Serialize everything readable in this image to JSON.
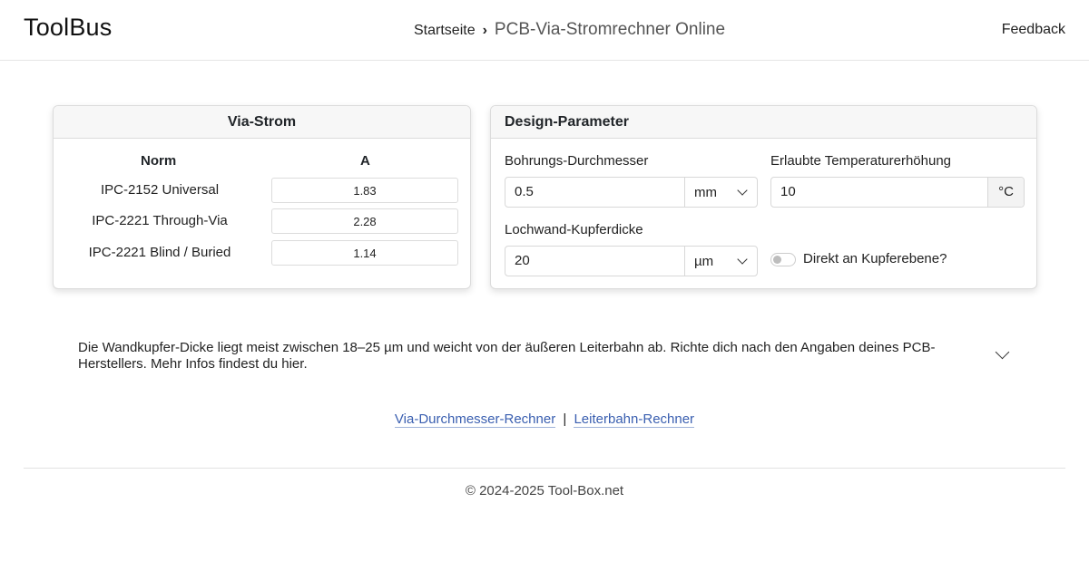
{
  "header": {
    "brand": "ToolBus",
    "breadcrumb_home": "Startseite",
    "breadcrumb_separator": "›",
    "breadcrumb_current": "PCB-Via-Stromrechner Online",
    "feedback": "Feedback"
  },
  "via_current": {
    "title": "Via-Strom",
    "col_norm": "Norm",
    "col_unit": "A",
    "rows": [
      {
        "label": "IPC-2152 Universal",
        "value": "1.83"
      },
      {
        "label": "IPC-2221 Through-Via",
        "value": "2.28"
      },
      {
        "label": "IPC-2221 Blind / Buried",
        "value": "1.14"
      }
    ]
  },
  "design": {
    "title": "Design-Parameter",
    "drill_label": "Bohrungs-Durchmesser",
    "drill_value": "0.5",
    "drill_unit": "mm",
    "temp_label": "Erlaubte Temperaturerhöhung",
    "temp_value": "10",
    "temp_unit": "°C",
    "copper_label": "Lochwand-Kupferdicke",
    "copper_value": "20",
    "copper_unit": "µm",
    "plane_label": "Direkt an Kupferebene?",
    "plane_checked": false
  },
  "info": {
    "text": "Die Wandkupfer-Dicke liegt meist zwischen 18–25 µm und weicht von der äußeren Leiterbahn ab. Richte dich nach den Angaben deines PCB-Herstellers. Mehr Infos findest du hier."
  },
  "links": {
    "via_diameter": "Via-Durchmesser-Rechner",
    "separator": "|",
    "trace": "Leiterbahn-Rechner"
  },
  "footer": {
    "copyright": "© 2024-2025 Tool-Box.net"
  }
}
